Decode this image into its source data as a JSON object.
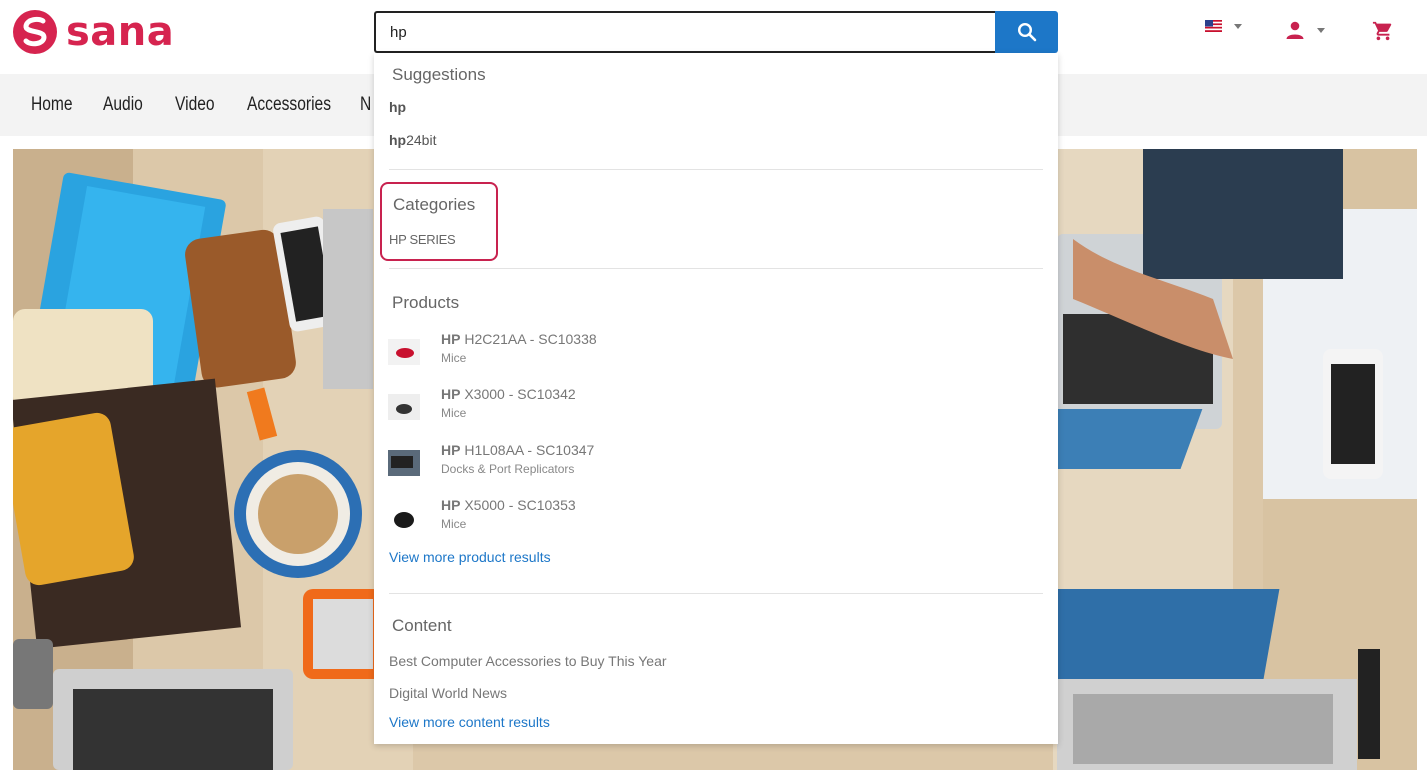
{
  "header": {
    "logo_text": "sana",
    "search": {
      "value": "hp"
    },
    "brand_color": "#d6244f",
    "accent_color": "#1d77c8"
  },
  "nav": {
    "items": [
      {
        "label": "Home"
      },
      {
        "label": "Audio"
      },
      {
        "label": "Video"
      },
      {
        "label": "Accessories"
      },
      {
        "label": "N"
      }
    ]
  },
  "dropdown": {
    "suggestions": {
      "title": "Suggestions",
      "items": [
        {
          "match": "hp",
          "rest": ""
        },
        {
          "match": "hp",
          "rest": "24bit"
        }
      ]
    },
    "categories": {
      "title": "Categories",
      "items": [
        {
          "label": "HP SERIES"
        }
      ]
    },
    "products": {
      "title": "Products",
      "items": [
        {
          "brand": "HP",
          "name": " H2C21AA - SC10338",
          "category": "Mice"
        },
        {
          "brand": "HP",
          "name": " X3000 - SC10342",
          "category": "Mice"
        },
        {
          "brand": "HP",
          "name": " H1L08AA - SC10347",
          "category": "Docks & Port Replicators"
        },
        {
          "brand": "HP",
          "name": " X5000 - SC10353",
          "category": "Mice"
        }
      ],
      "more_link": "View more product results"
    },
    "content": {
      "title": "Content",
      "items": [
        {
          "label": "Best Computer Accessories to Buy This Year"
        },
        {
          "label": "Digital World News"
        }
      ],
      "more_link": "View more content results"
    }
  },
  "icons": {
    "search": "search-icon",
    "flag": "us-flag-icon",
    "user": "user-icon",
    "cart": "cart-icon"
  }
}
